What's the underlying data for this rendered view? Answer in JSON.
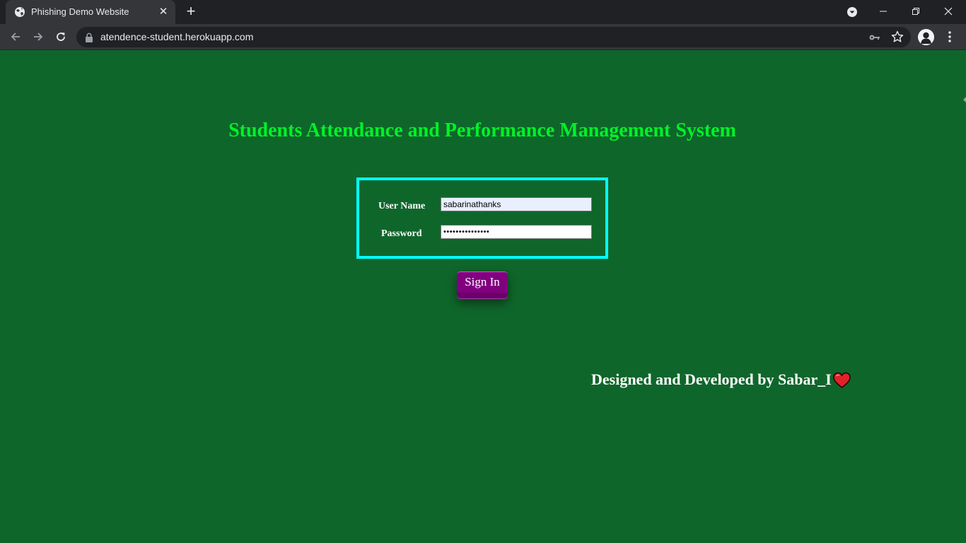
{
  "browser": {
    "tab_title": "Phishing Demo Website",
    "url": "atendence-student.herokuapp.com"
  },
  "page": {
    "title": "Students Attendance and Performance Management System",
    "form": {
      "username_label": "User Name",
      "username_value": "sabarinathanks",
      "password_label": "Password",
      "password_value": "•••••••••••••••",
      "signin_label": "Sign In"
    },
    "footer": "Designed and Developed by Sabar_I"
  },
  "colors": {
    "background": "#0f662b",
    "title": "#00f228",
    "box_border": "#00ffff",
    "button": "#800080",
    "heart": "#e0222a"
  },
  "icons": {
    "favicon": "globe-icon",
    "heart": "heart-icon"
  }
}
